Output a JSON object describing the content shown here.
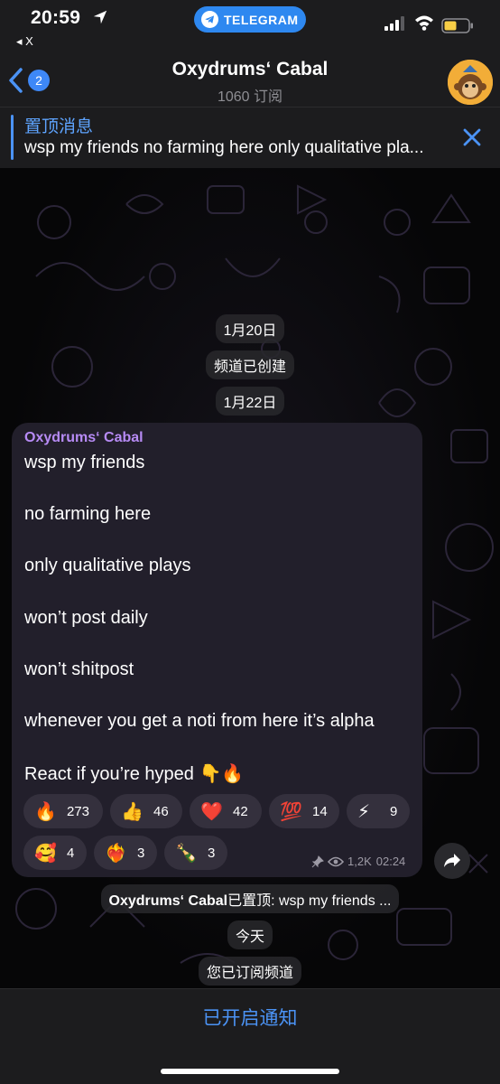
{
  "status_bar": {
    "time": "20:59",
    "back_app": "◂ X",
    "app_pill": "TELEGRAM"
  },
  "header": {
    "back_badge": "2",
    "title": "Oxydrums‘ Cabal",
    "subtitle": "1060 订阅"
  },
  "pinned": {
    "title": "置顶消息",
    "text": "wsp my friends no farming here only qualitative pla..."
  },
  "service": {
    "date1": "1月20日",
    "created": "频道已创建",
    "date2": "1月22日",
    "pinned_author": "Oxydrums‘ Cabal",
    "pinned_note": " 已置顶: wsp my friends ...",
    "today": "今天",
    "subscribed": "您已订阅频道"
  },
  "message": {
    "author": "Oxydrums‘ Cabal",
    "lines": [
      "wsp my friends",
      "no farming here",
      "only qualitative plays",
      "won’t post daily",
      "won’t shitpost",
      "whenever you get a noti from here it’s alpha",
      "React if you’re hyped 👇🔥"
    ],
    "reactions": [
      {
        "emoji": "🔥",
        "count": "273"
      },
      {
        "emoji": "👍",
        "count": "46"
      },
      {
        "emoji": "❤️",
        "count": "42"
      },
      {
        "emoji": "💯",
        "count": "14"
      },
      {
        "emoji": "⚡",
        "count": "9"
      },
      {
        "emoji": "🥰",
        "count": "4"
      },
      {
        "emoji": "❤️‍🔥",
        "count": "3"
      },
      {
        "emoji": "🍾",
        "count": "3"
      }
    ],
    "views": "1,2K",
    "time": "02:24"
  },
  "bottom": {
    "button": "已开启通知"
  },
  "colors": {
    "accent": "#4b93f5",
    "author": "#b78bf5",
    "bubble": "#221f2b",
    "bars": "#1c1c1e"
  }
}
